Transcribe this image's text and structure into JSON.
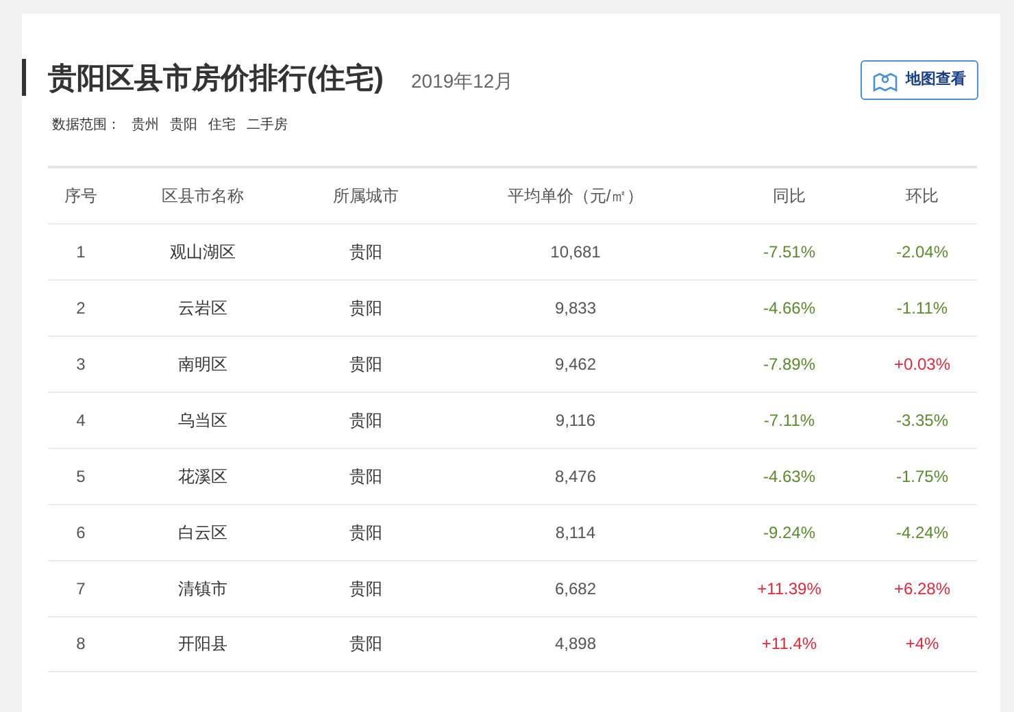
{
  "header": {
    "title": "贵阳区县市房价排行(住宅)",
    "date": "2019年12月",
    "map_button": "地图查看",
    "scope_label": "数据范围：",
    "scope_tags": [
      "贵州",
      "贵阳",
      "住宅",
      "二手房"
    ]
  },
  "table": {
    "columns": [
      "序号",
      "区县市名称",
      "所属城市",
      "平均单价（元/㎡）",
      "同比",
      "环比"
    ],
    "rows": [
      {
        "rank": "1",
        "name": "观山湖区",
        "city": "贵阳",
        "price": "10,681",
        "yoy": {
          "text": "-7.51%",
          "color": "#5b8a2d"
        },
        "mom": {
          "text": "-2.04%",
          "color": "#5b8a2d"
        }
      },
      {
        "rank": "2",
        "name": "云岩区",
        "city": "贵阳",
        "price": "9,833",
        "yoy": {
          "text": "-4.66%",
          "color": "#5b8a2d"
        },
        "mom": {
          "text": "-1.11%",
          "color": "#5b8a2d"
        }
      },
      {
        "rank": "3",
        "name": "南明区",
        "city": "贵阳",
        "price": "9,462",
        "yoy": {
          "text": "-7.89%",
          "color": "#5b8a2d"
        },
        "mom": {
          "text": "+0.03%",
          "color": "#e02a3c"
        }
      },
      {
        "rank": "4",
        "name": "乌当区",
        "city": "贵阳",
        "price": "9,116",
        "yoy": {
          "text": "-7.11%",
          "color": "#5b8a2d"
        },
        "mom": {
          "text": "-3.35%",
          "color": "#5b8a2d"
        }
      },
      {
        "rank": "5",
        "name": "花溪区",
        "city": "贵阳",
        "price": "8,476",
        "yoy": {
          "text": "-4.63%",
          "color": "#5b8a2d"
        },
        "mom": {
          "text": "-1.75%",
          "color": "#5b8a2d"
        }
      },
      {
        "rank": "6",
        "name": "白云区",
        "city": "贵阳",
        "price": "8,114",
        "yoy": {
          "text": "-9.24%",
          "color": "#5b8a2d"
        },
        "mom": {
          "text": "-4.24%",
          "color": "#5b8a2d"
        }
      },
      {
        "rank": "7",
        "name": "清镇市",
        "city": "贵阳",
        "price": "6,682",
        "yoy": {
          "text": "+11.39%",
          "color": "#e02a3c"
        },
        "mom": {
          "text": "+6.28%",
          "color": "#e02a3c"
        }
      },
      {
        "rank": "8",
        "name": "开阳县",
        "city": "贵阳",
        "price": "4,898",
        "yoy": {
          "text": "+11.4%",
          "color": "#e02a3c"
        },
        "mom": {
          "text": "+4%",
          "color": "#e02a3c"
        }
      }
    ]
  }
}
